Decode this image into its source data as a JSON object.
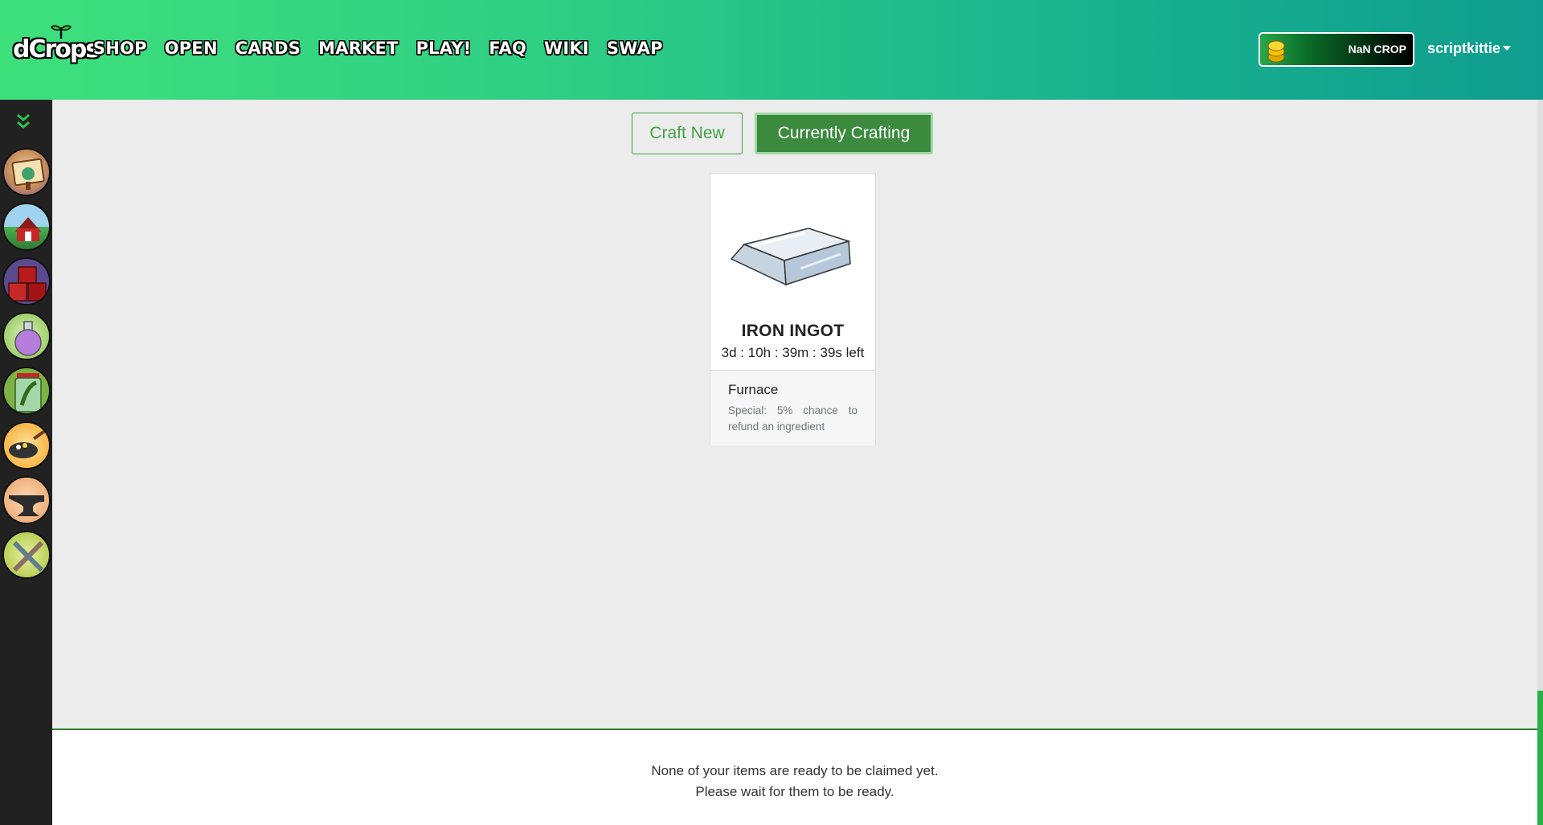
{
  "header": {
    "logo_text": "dCrops",
    "nav": [
      {
        "label": "SHOP"
      },
      {
        "label": "OPEN"
      },
      {
        "label": "CARDS"
      },
      {
        "label": "MARKET"
      },
      {
        "label": "PLAY!"
      },
      {
        "label": "FAQ"
      },
      {
        "label": "WIKI"
      },
      {
        "label": "SWAP"
      }
    ],
    "balance": "NaN CROP",
    "username": "scriptkittie"
  },
  "sidebar": {
    "items": [
      {
        "icon": "dashboard-icon"
      },
      {
        "icon": "farm-barn-icon"
      },
      {
        "icon": "crates-icon"
      },
      {
        "icon": "potion-icon"
      },
      {
        "icon": "jar-icon"
      },
      {
        "icon": "cooking-pan-icon"
      },
      {
        "icon": "anvil-icon"
      },
      {
        "icon": "tools-icon"
      }
    ]
  },
  "tabs": {
    "craft_new": "Craft New",
    "currently_crafting": "Currently Crafting"
  },
  "crafting_item": {
    "name": "IRON INGOT",
    "time_left": "3d : 10h : 39m : 39s left",
    "station": "Furnace",
    "special": "Special: 5% chance to refund an ingredient"
  },
  "claim_message": {
    "line1": "None of your items are ready to be claimed yet.",
    "line2": "Please wait for them to be ready."
  },
  "colors": {
    "accent": "#3b8a3e",
    "header_start": "#3ee07c",
    "header_end": "#0f9d8f",
    "sidebar": "#212121"
  }
}
